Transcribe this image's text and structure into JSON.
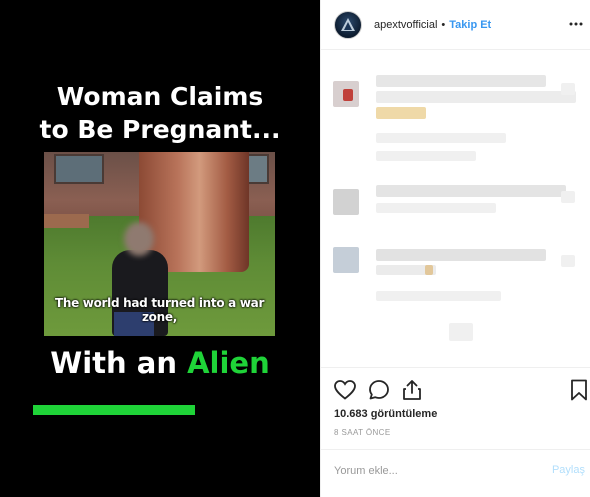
{
  "post": {
    "headline_line1": "Woman Claims",
    "headline_line2": "to Be Pregnant...",
    "subtitle": "The world had turned into a war zone,",
    "tagline_prefix": "With an ",
    "tagline_accent": "Alien",
    "accent_color": "#1fd338",
    "video_progress_percent": 50
  },
  "header": {
    "username": "apextvofficial",
    "separator": "•",
    "follow_label": "Takip Et",
    "more_icon": "more-horizontal-icon"
  },
  "actions": {
    "like_icon": "heart-icon",
    "comment_icon": "comment-bubble-icon",
    "share_icon": "share-upload-icon",
    "save_icon": "bookmark-icon",
    "views": "10.683 görüntüleme",
    "time": "8 SAAT ÖNCE"
  },
  "comment_box": {
    "placeholder": "Yorum ekle...",
    "submit_label": "Paylaş"
  }
}
